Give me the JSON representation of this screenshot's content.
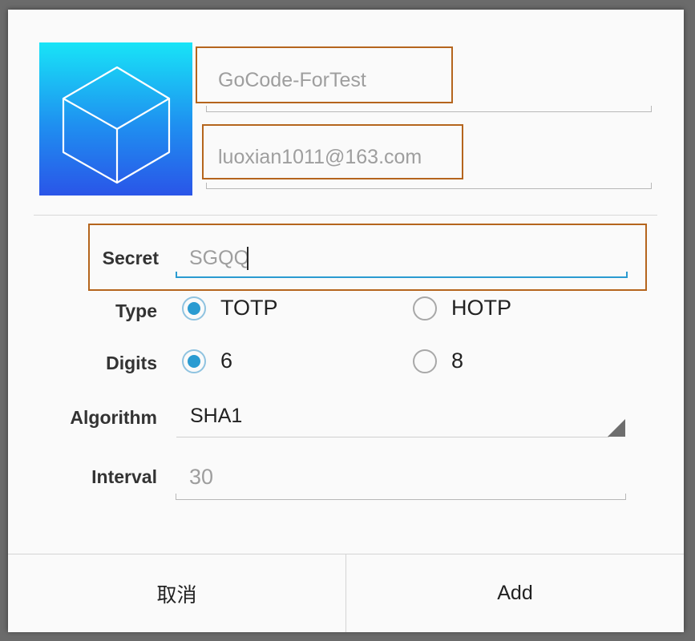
{
  "account": {
    "issuer_value": "GoCode-ForTest",
    "account_value": "luoxian1011@163.com",
    "logo_icon": "cube-icon"
  },
  "form": {
    "secret": {
      "label": "Secret",
      "value": "SGQQ"
    },
    "type": {
      "label": "Type",
      "options": [
        "TOTP",
        "HOTP"
      ],
      "selected": "TOTP"
    },
    "digits": {
      "label": "Digits",
      "options": [
        "6",
        "8"
      ],
      "selected": "6"
    },
    "algorithm": {
      "label": "Algorithm",
      "selected": "SHA1"
    },
    "interval": {
      "label": "Interval",
      "placeholder": "30"
    }
  },
  "buttons": {
    "cancel_label": "取消",
    "add_label": "Add"
  },
  "colors": {
    "accent": "#2a9bd1",
    "highlight_box": "#b5651d",
    "logo_gradient_top": "#18e4f7",
    "logo_gradient_bottom": "#2a55e8"
  }
}
